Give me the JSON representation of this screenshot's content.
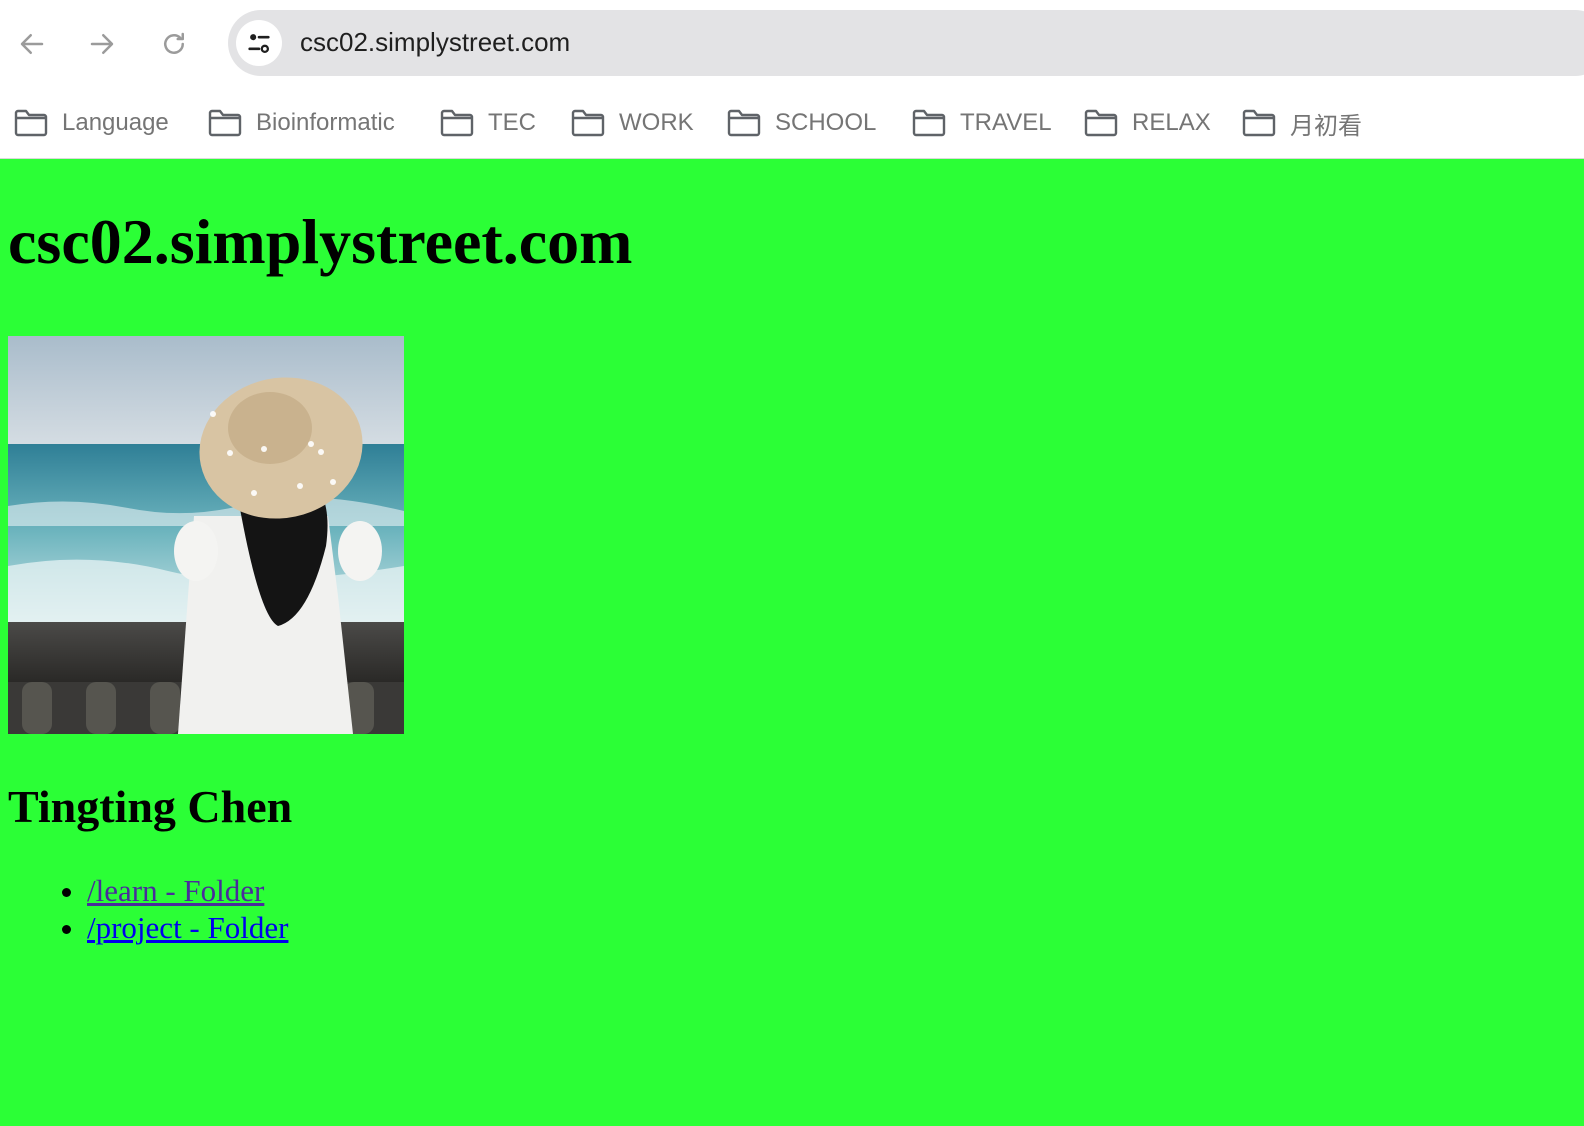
{
  "browser": {
    "url": "csc02.simplystreet.com",
    "bookmarks": [
      {
        "label": "Language"
      },
      {
        "label": "Bioinformatic"
      },
      {
        "label": "TEC"
      },
      {
        "label": "WORK"
      },
      {
        "label": "SCHOOL"
      },
      {
        "label": "TRAVEL"
      },
      {
        "label": "RELAX"
      },
      {
        "label": "月初看"
      }
    ]
  },
  "page": {
    "title": "csc02.simplystreet.com",
    "owner_name": "Tingting Chen",
    "links": [
      {
        "label": "/learn - Folder",
        "visited": true
      },
      {
        "label": "/project - Folder",
        "visited": false
      }
    ],
    "background_color": "#2bff36"
  },
  "icons": {
    "back": "arrow-left-icon",
    "forward": "arrow-right-icon",
    "reload": "reload-icon",
    "site_info": "tune-icon",
    "bookmark_folder": "folder-icon"
  }
}
